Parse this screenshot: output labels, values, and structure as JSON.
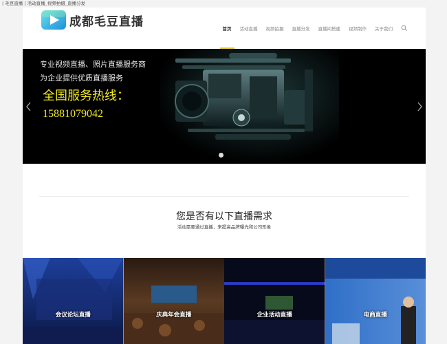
{
  "page": {
    "tab_title": "| 毛豆直播 | 活动直播_视频拍摄_直播分发"
  },
  "header": {
    "logo_text": "成都毛豆直播",
    "nav": [
      {
        "label": "首页",
        "active": true
      },
      {
        "label": "活动直播"
      },
      {
        "label": "视频拍摄"
      },
      {
        "label": "直播分发"
      },
      {
        "label": "直播间搭建"
      },
      {
        "label": "视频制作"
      },
      {
        "label": "关于我们"
      }
    ]
  },
  "slider": {
    "line1": "专业视频直播、照片直播服务商",
    "line2": "为企业提供优质直播服务",
    "hotline": "全国服务热线：",
    "phone": "15881079042"
  },
  "needs": {
    "title": "您是否有以下直播需求",
    "subtitle": "活动需要通过直播，来提高品牌曝光和公司形象"
  },
  "tiles": [
    {
      "label": "会议论坛直播"
    },
    {
      "label": "庆典年会直播"
    },
    {
      "label": "企业活动直播"
    },
    {
      "label": "电商直播"
    }
  ],
  "colors": {
    "accent_yellow": "#f2ea1c",
    "nav_active_underline": "#e4c93a"
  },
  "icons": {
    "logo": "play-icon",
    "search": "search-icon",
    "prev": "chevron-left-icon",
    "next": "chevron-right-icon"
  }
}
